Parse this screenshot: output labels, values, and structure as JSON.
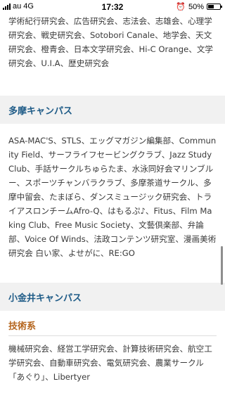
{
  "status_bar": {
    "carrier": "au",
    "network": "4G",
    "time": "17:32",
    "battery": "50%",
    "battery_level": 0.5
  },
  "intro_text": "学術紀行研究会、広告研究会、志法会、志雄会、心理学研究会、戦史研究会、Sotobori Canale、地学会、天文研究会、橙青会、日本文学研究会、Hi-C Orange、文学研究会、U.I.A、歴史研究会",
  "tama": {
    "header": "多摩キャンパス",
    "text": "ASA-MAC'S、STLS、エッグマガジン編集部、Community Field、サーフライフセービングクラブ、Jazz Study Club、手話サークルちゅらたま、水泳同好会マリンブルー、スポーツチャンバラクラブ、多摩茶道サークル、多摩中留会、たまぼら、ダンスミュージック研究会、トライアスロンチームAfro-Q、はもるぷ♪、Fitus、Film Making Club、Free Music Society、文藝倶楽部、弁論部、Voice Of Winds、法政コンテンツ研究室、漫画美術研究会 白い家、よせがに、RE:GO"
  },
  "koganei": {
    "header": "小金井キャンパス",
    "subheader": "技術系",
    "text": "機械研究会、経営工学研究会、計算技術研究会、航空工学研究会、自動車研究会、電気研究会、農業サークル「あぐり」、Libertyer"
  },
  "colors": {
    "section_header_text": "#1e5b87",
    "subheader_text": "#b5651d",
    "section_header_bg": "#f1f1f1"
  }
}
